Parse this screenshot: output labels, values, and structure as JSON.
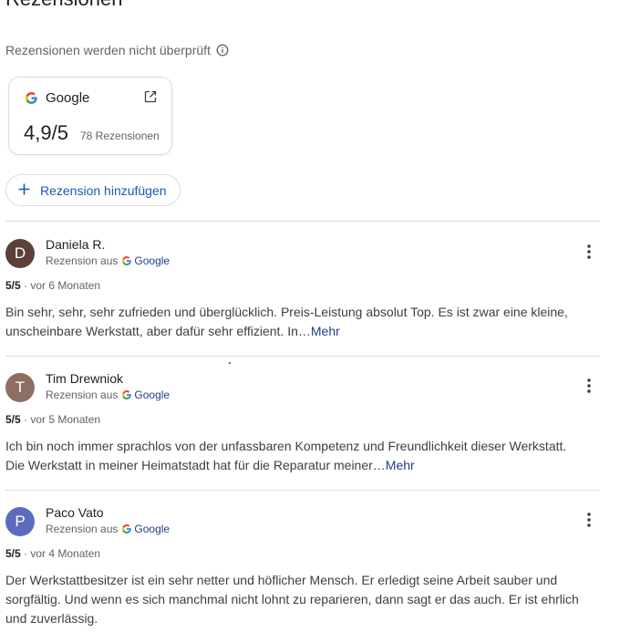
{
  "section": {
    "heading": "Rezensionen",
    "unverified_note": "Rezensionen werden nicht überprüft"
  },
  "source_card": {
    "name": "Google",
    "score": "4,9/5",
    "count": "78 Rezensionen"
  },
  "add_review_label": "Rezension hinzufügen",
  "reviews": [
    {
      "initial": "D",
      "name": "Daniela R.",
      "via_prefix": "Rezension aus",
      "via_source": "Google",
      "score": "5/5",
      "age": " · vor 6 Monaten",
      "text": "Bin sehr, sehr, sehr zufrieden und überglücklich. Preis-Leistung absolut Top. Es ist zwar eine kleine, unscheinbare Werkstatt, aber dafür sehr effizient. In",
      "ellipsis": "…",
      "more": "Mehr",
      "avatar_color": "#5d4037"
    },
    {
      "initial": "T",
      "name": "Tim Drewniok",
      "via_prefix": "Rezension aus",
      "via_source": "Google",
      "score": "5/5",
      "age": " · vor 5 Monaten",
      "text": "Ich bin noch immer sprachlos von der unfassbaren Kompetenz und Freundlichkeit dieser Werkstatt. Die Werkstatt in meiner Heimatstadt hat für die Reparatur meiner",
      "ellipsis": "…",
      "more": "Mehr",
      "avatar_color": "#8d6e63"
    },
    {
      "initial": "P",
      "name": "Paco Vato",
      "via_prefix": "Rezension aus",
      "via_source": "Google",
      "score": "5/5",
      "age": " · vor 4 Monaten",
      "text": "Der Werkstattbesitzer ist ein sehr netter und höflicher Mensch. Er erledigt seine Arbeit sauber und sorgfältig. Und wenn es sich manchmal nicht lohnt zu reparieren, dann sagt er das auch. Er ist ehrlich und zuverlässig.",
      "avatar_color": "#5c6bc0"
    }
  ],
  "icons": {
    "info": "info-icon",
    "google_logo": "google-logo-icon",
    "open_external": "open-in-new-icon",
    "add": "plus-icon",
    "more": "more-vert-icon"
  },
  "colors": {
    "link": "#1f3e8a",
    "button_text": "#1a57b5",
    "divider": "#dadce0",
    "secondary_text": "#5f6368"
  }
}
